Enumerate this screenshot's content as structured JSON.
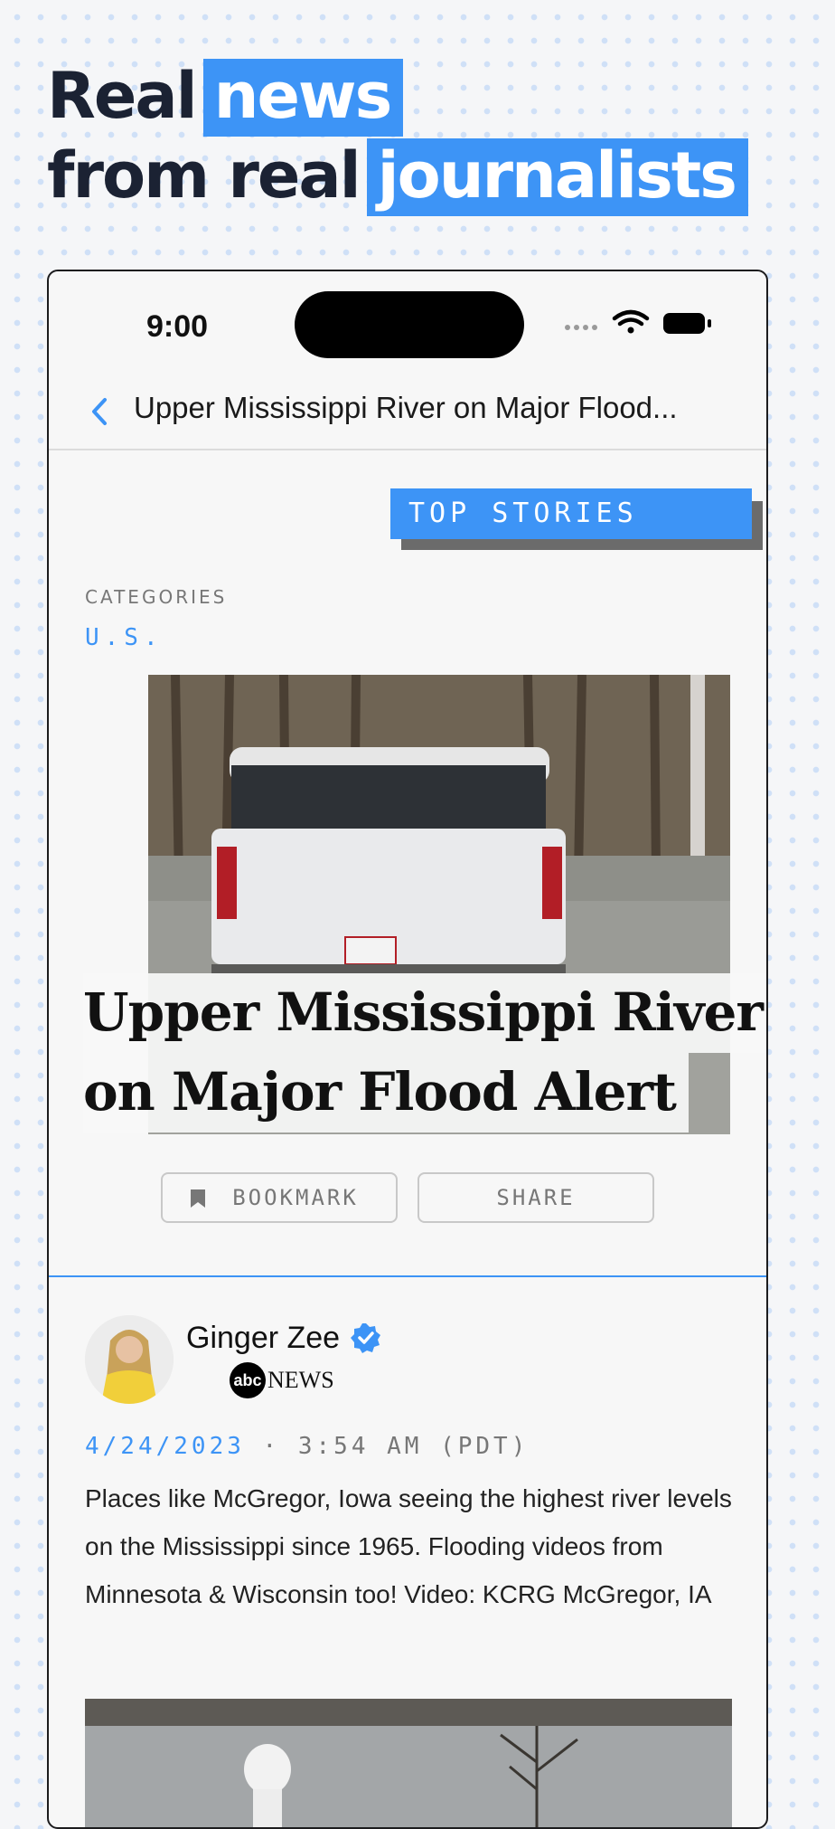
{
  "promo": {
    "headline_line1_plain": "Real",
    "headline_line1_highlight": "news",
    "headline_line2_plain": "from real",
    "headline_line2_highlight": "journalists"
  },
  "status_bar": {
    "time": "9:00"
  },
  "nav": {
    "title": "Upper Mississippi River on Major Flood..."
  },
  "article": {
    "section_tag": "TOP STORIES",
    "categories_label": "CATEGORIES",
    "category": "U.S.",
    "title_line1": "Upper Mississippi River",
    "title_line2": "on Major Flood Alert",
    "bookmark_label": "BOOKMARK",
    "share_label": "SHARE"
  },
  "post": {
    "author_name": "Ginger Zee",
    "outlet_logo_text": "abc",
    "outlet_name": "NEWS",
    "date": "4/24/2023",
    "separator": "·",
    "time": "3:54 AM (PDT)",
    "body": "Places like McGregor, Iowa seeing the highest river levels on the Mississippi since 1965. Flooding videos from Minnesota & Wisconsin too! Video: KCRG McGregor, IA"
  },
  "colors": {
    "accent": "#3d94f6",
    "headline_text": "#1b2233",
    "background": "#f5f6f8"
  },
  "icons": [
    "back-chevron-icon",
    "wifi-icon",
    "battery-icon",
    "cellular-signal-icon",
    "bookmark-icon",
    "verified-badge-icon"
  ]
}
